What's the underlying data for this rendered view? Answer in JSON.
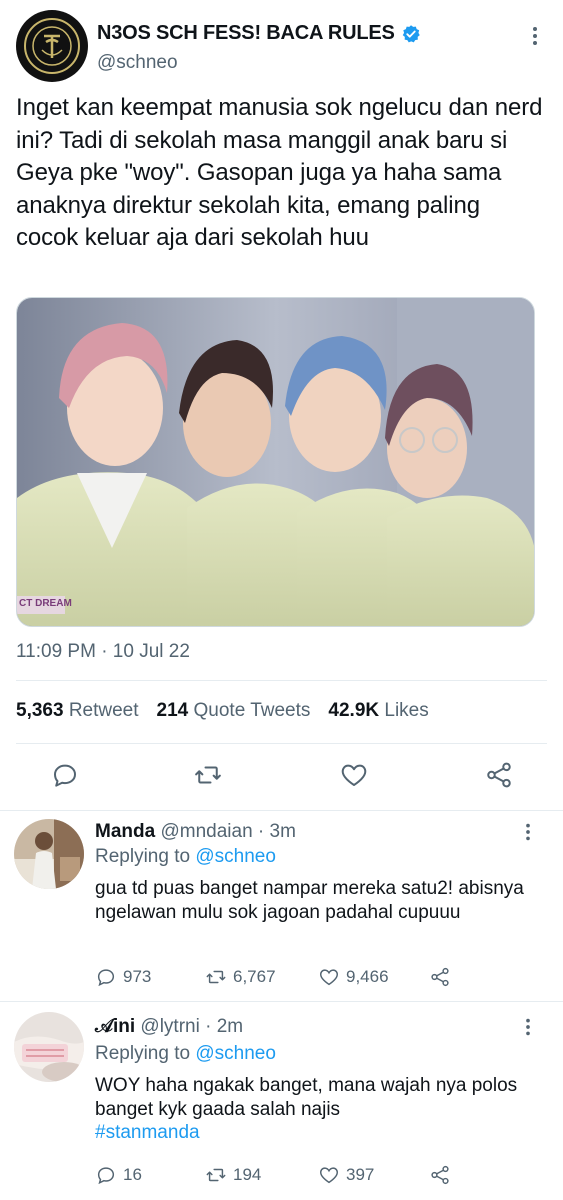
{
  "account": {
    "name": "N3OS SCH FESS! BACA RULES",
    "handle": "@schneo",
    "logo_text": "NCTNM"
  },
  "tweet": {
    "text": "Inget kan keempat manusia sok ngelucu dan nerd ini? Tadi di sekolah masa manggil anak baru si Geya pke \"woy\". Gasopan juga ya haha sama anaknya direktur sekolah kita, emang paling cocok keluar aja dari sekolah huu",
    "photo_caption": "CT DREAM",
    "timestamp": "11:09 PM · 10 Jul 22"
  },
  "stats": {
    "retweets": "5,363",
    "retweets_label": "Retweet",
    "quotes": "214",
    "quotes_label": "Quote Tweets",
    "likes": "42.9K",
    "likes_label": "Likes"
  },
  "replies": [
    {
      "name": "Manda",
      "handle": "@mndaian",
      "time": "· 3m",
      "replying_prefix": "Replying to",
      "replying_to": "@schneo",
      "text": "gua td puas banget nampar mereka satu2! abisnya ngelawan mulu sok jagoan padahal cupuuu",
      "hashtag": "",
      "counts": {
        "replies": "973",
        "retweets": "6,767",
        "likes": "9,466"
      }
    },
    {
      "name": "𝒜ini",
      "handle": "@lytrni",
      "time": "· 2m",
      "replying_prefix": "Replying to",
      "replying_to": "@schneo",
      "text": "WOY haha ngakak banget, mana wajah nya polos banget kyk gaada salah najis",
      "hashtag": "#stanmanda",
      "counts": {
        "replies": "16",
        "retweets": "194",
        "likes": "397"
      }
    }
  ],
  "colors": {
    "accent": "#1d9bf0",
    "text": "#0f1419",
    "muted": "#536471",
    "divider": "#e6ecf0"
  },
  "icons": [
    "verified-badge-icon",
    "more-vertical-icon",
    "reply-icon",
    "retweet-icon",
    "like-icon",
    "share-icon"
  ]
}
